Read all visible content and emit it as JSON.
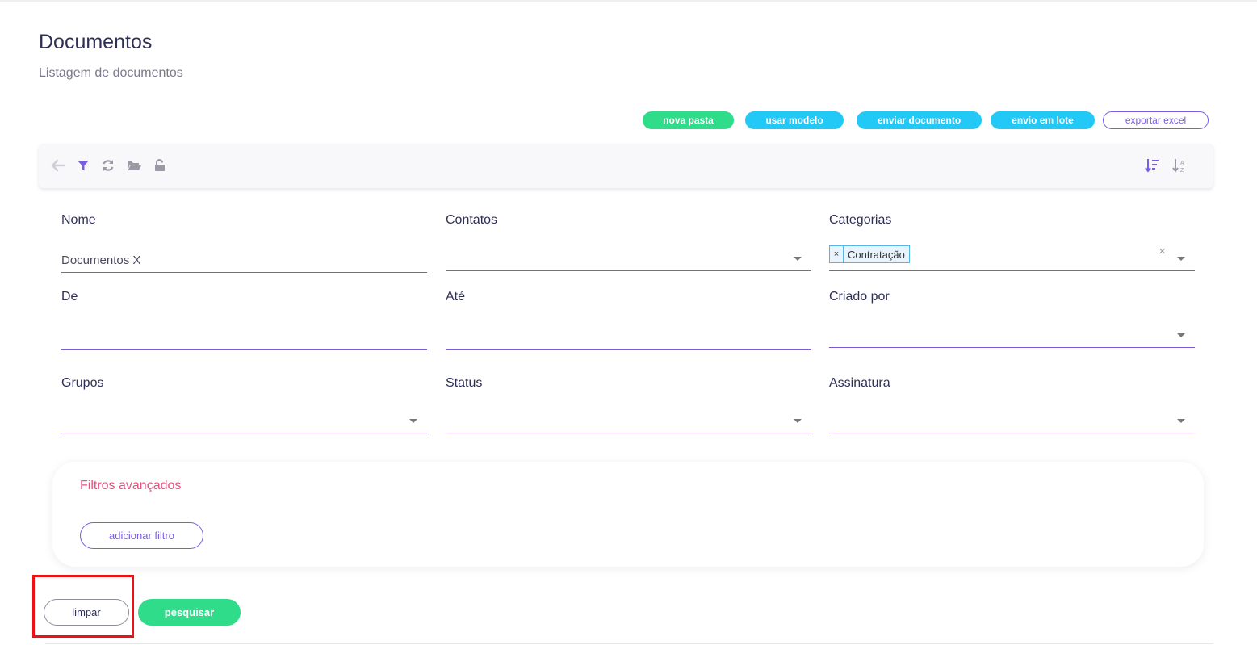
{
  "page": {
    "title": "Documentos",
    "subtitle": "Listagem de documentos"
  },
  "actions": {
    "nova_pasta": "nova pasta",
    "usar_modelo": "usar modelo",
    "enviar_documento": "enviar documento",
    "envio_em_lote": "envio em lote",
    "exportar_excel": "exportar excel"
  },
  "toolbar": {
    "icons": [
      "back-arrow-icon",
      "filter-icon",
      "refresh-icon",
      "folder-open-icon",
      "unlock-icon",
      "sort-amount-down-icon",
      "sort-alpha-down-icon"
    ],
    "accent": "#7a5ce6"
  },
  "filters": {
    "nome": {
      "label": "Nome",
      "value": "Documentos X"
    },
    "contatos": {
      "label": "Contatos",
      "value": ""
    },
    "categorias": {
      "label": "Categorias",
      "tags": [
        "Contratação"
      ],
      "tag_remove": "×",
      "clear": "×"
    },
    "de": {
      "label": "De",
      "value": ""
    },
    "ate": {
      "label": "Até",
      "value": ""
    },
    "criado_por": {
      "label": "Criado por",
      "value": ""
    },
    "grupos": {
      "label": "Grupos",
      "value": ""
    },
    "status": {
      "label": "Status",
      "value": ""
    },
    "assinatura": {
      "label": "Assinatura",
      "value": ""
    }
  },
  "advanced": {
    "title": "Filtros avançados",
    "add_button": "adicionar filtro"
  },
  "footer": {
    "clear_button": "limpar",
    "search_button": "pesquisar"
  },
  "colors": {
    "green": "#2edc8a",
    "cyan": "#22c8f6",
    "purple": "#7a5ce6",
    "pink": "#ea4f7f",
    "highlight": "#ee1111"
  }
}
